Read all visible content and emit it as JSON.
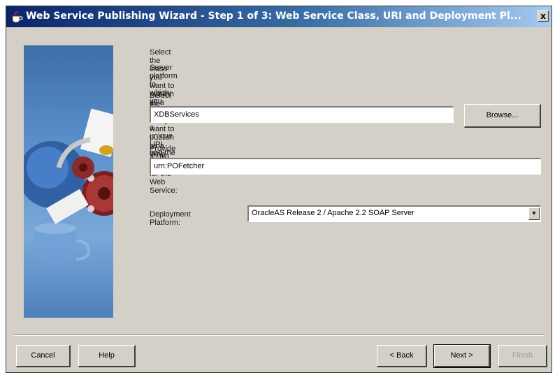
{
  "window": {
    "title": "Web Service Publishing Wizard - Step 1 of 3: Web Service Class, URI and Deployment Pl...",
    "close_label": "x"
  },
  "intro": {
    "line1": "Select the class you want to publish as a Web Service, a unique URI and the SOAP",
    "line2": "Server platform to which you want to deploy."
  },
  "class_field": {
    "label": "Select the class that you want to publish as a Web Service:",
    "value": "XDBServices"
  },
  "browse_button": {
    "label": "Browse..."
  },
  "uri_field": {
    "label": "Provide a URI identifier for the Web Service:",
    "value": "urn:POFetcher"
  },
  "platform": {
    "label": "Deployment Platform:",
    "selected": "OracleAS Release 2 / Apache 2.2 SOAP Server"
  },
  "buttons": {
    "cancel": "Cancel",
    "help": "Help",
    "back": "< Back",
    "next": "Next >",
    "finish": "Finish"
  },
  "colors": {
    "dialog_bg": "#d4d0c8",
    "title_bar": "#0a246a",
    "side_panel": "#5a8fca"
  },
  "icons": [
    "coffee-cup-title-icon",
    "web-service-wizard-illustration",
    "close-icon",
    "dropdown-arrow-icon"
  ]
}
